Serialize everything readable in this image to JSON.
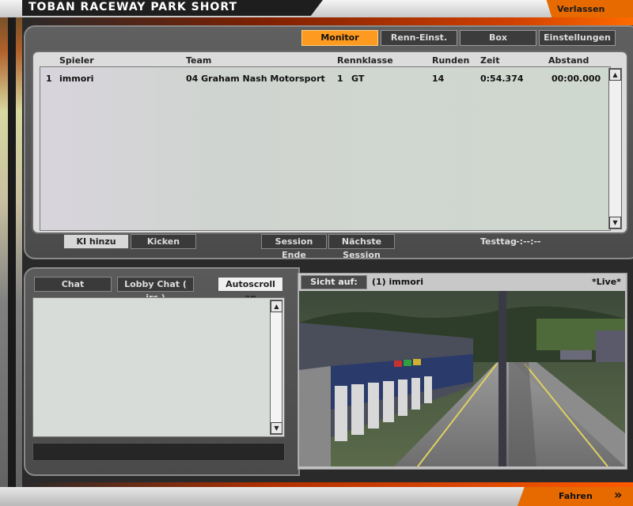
{
  "window": {
    "title": "TOBAN RACEWAY PARK SHORT",
    "exit_label": "Verlassen",
    "go_label": "Fahren"
  },
  "tabs": [
    {
      "label": "Monitor",
      "active": true
    },
    {
      "label": "Renn-Einst.",
      "active": false
    },
    {
      "label": "Box",
      "active": false
    },
    {
      "label": "Einstellungen",
      "active": false
    }
  ],
  "table": {
    "headers": {
      "player": "Spieler",
      "team": "Team",
      "class": "Rennklasse",
      "laps": "Runden",
      "time": "Zeit",
      "gap": "Abstand"
    },
    "rows": [
      {
        "pos": "1",
        "player": "immori",
        "team": "04 Graham Nash Motorsport",
        "class_num": "1",
        "class": "GT",
        "laps": "14",
        "time": "0:54.374",
        "gap": "00:00.000"
      }
    ]
  },
  "actions": {
    "add_ai": "KI hinzu",
    "kick": "Kicken",
    "end_session": "Session Ende",
    "next_session": "Nächste Session",
    "session_label": "Testtag",
    "session_time": "-:--:--"
  },
  "chat": {
    "chat_tab": "Chat",
    "lobby_tab": "Lobby Chat ( irc )",
    "autoscroll": "Autoscroll an"
  },
  "camera": {
    "view_label": "Sicht auf:",
    "target": "(1) immori",
    "live": "*Live*"
  },
  "colors": {
    "accent": "#e66a00",
    "active_tab": "#ff9a20"
  }
}
